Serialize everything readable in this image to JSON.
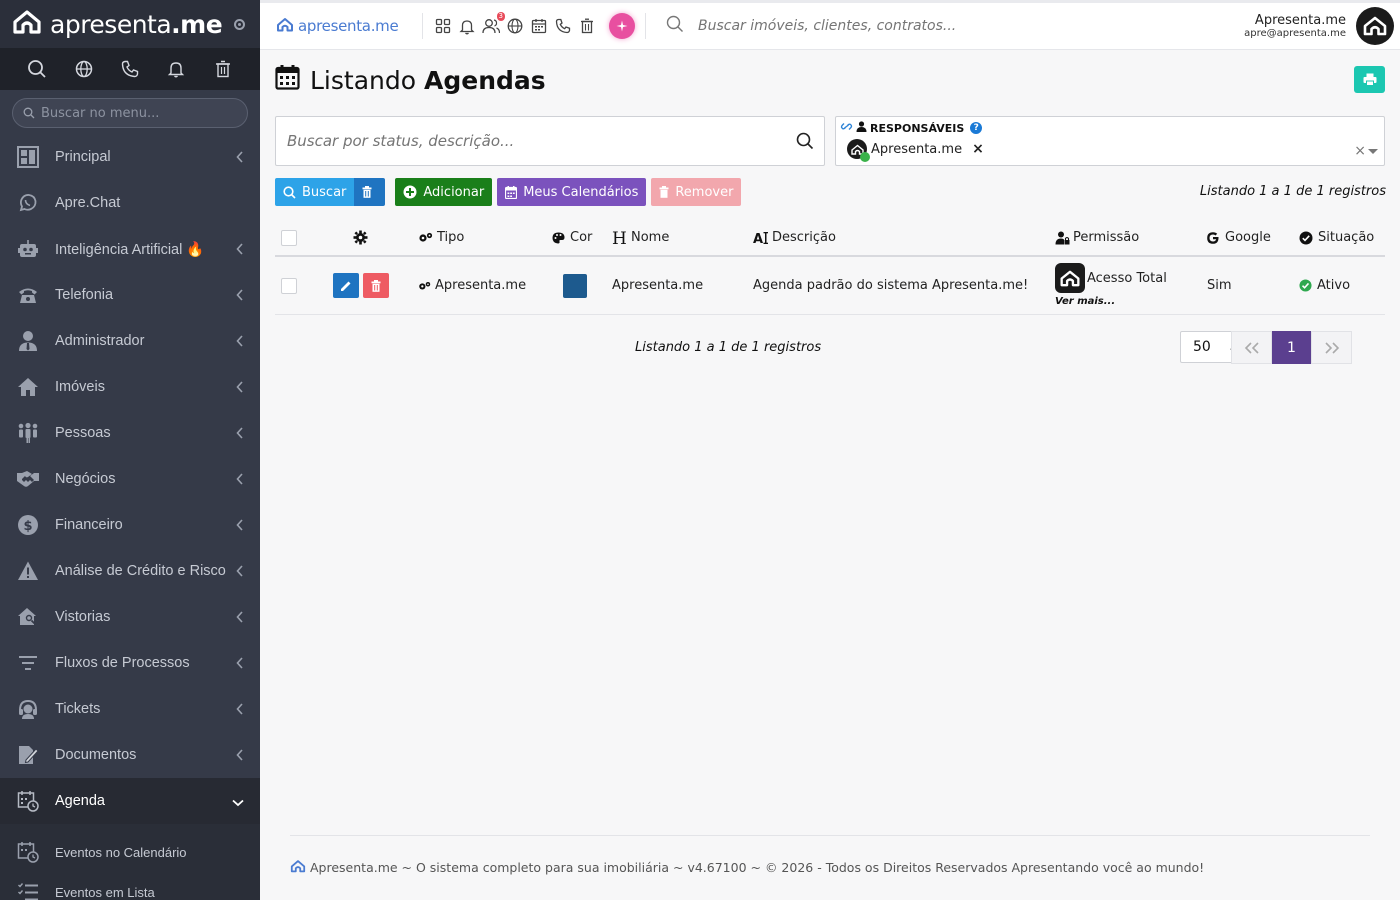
{
  "app": {
    "brand": "apresenta",
    "brand_suffix": ".me",
    "top_brand": "apresenta.me"
  },
  "sidebar": {
    "search_placeholder": "Buscar no menu...",
    "quick_icons": [
      "search-icon",
      "globe-icon",
      "phone-icon",
      "bell-icon",
      "trash-icon"
    ],
    "items": [
      {
        "label": "Principal",
        "icon": "dashboard-icon",
        "has_children": true
      },
      {
        "label": "Apre.Chat",
        "icon": "whatsapp-icon",
        "has_children": false
      },
      {
        "label": "Inteligência Artificial 🔥",
        "icon": "robot-icon",
        "has_children": true
      },
      {
        "label": "Telefonia",
        "icon": "phone-icon",
        "has_children": true
      },
      {
        "label": "Administrador",
        "icon": "user-tie-icon",
        "has_children": true
      },
      {
        "label": "Imóveis",
        "icon": "home-icon",
        "has_children": true
      },
      {
        "label": "Pessoas",
        "icon": "people-icon",
        "has_children": true
      },
      {
        "label": "Negócios",
        "icon": "handshake-icon",
        "has_children": true
      },
      {
        "label": "Financeiro",
        "icon": "dollar-icon",
        "has_children": true
      },
      {
        "label": "Análise de Crédito e Risco",
        "icon": "warning-icon",
        "has_children": true
      },
      {
        "label": "Vistorias",
        "icon": "house-search-icon",
        "has_children": true
      },
      {
        "label": "Fluxos de Processos",
        "icon": "filter-icon",
        "has_children": true
      },
      {
        "label": "Tickets",
        "icon": "headset-icon",
        "has_children": true
      },
      {
        "label": "Documentos",
        "icon": "document-edit-icon",
        "has_children": true
      },
      {
        "label": "Agenda",
        "icon": "calendar-clock-icon",
        "has_children": true,
        "expanded": true
      }
    ],
    "subitems": [
      {
        "label": "Eventos no Calendário",
        "icon": "calendar-clock-icon"
      },
      {
        "label": "Eventos em Lista",
        "icon": "list-icon"
      }
    ]
  },
  "topbar": {
    "icons": [
      "apps-icon",
      "bell-icon",
      "users-icon",
      "globe-icon",
      "calendar-icon",
      "phone-icon",
      "trash-icon"
    ],
    "users_badge": "3",
    "search_placeholder": "Buscar imóveis, clientes, contratos...",
    "user_name": "Apresenta.me",
    "user_email": "apre@apresenta.me"
  },
  "page": {
    "title_prefix": "Listando",
    "title_strong": "Agendas",
    "filter_placeholder": "Buscar por status, descrição...",
    "responsaveis_label": "RESPONSÁVEIS",
    "responsavel_chip": "Apresenta.me",
    "chip_remove": "×",
    "clear_all": "×"
  },
  "actions": {
    "search": "Buscar",
    "add": "Adicionar",
    "calendars": "Meus Calendários",
    "remove": "Remover"
  },
  "listing_info": "Listando 1 a 1 de 1 registros",
  "table": {
    "headers": {
      "tipo": "Tipo",
      "cor": "Cor",
      "nome": "Nome",
      "descricao": "Descrição",
      "permissao": "Permissão",
      "google": "Google",
      "situacao": "Situação"
    },
    "rows": [
      {
        "tipo": "Apresenta.me",
        "cor": "#1d5a8e",
        "nome": "Apresenta.me",
        "descricao": "Agenda padrão do sistema Apresenta.me!",
        "permissao": "Acesso Total",
        "ver_mais": "Ver mais...",
        "google": "Sim",
        "situacao": "Ativo"
      }
    ]
  },
  "pagination": {
    "info": "Listando 1 a 1 de 1 registros",
    "per_page": "50",
    "current_page": "1",
    "first": "«",
    "next": "»"
  },
  "footer": {
    "text": "Apresenta.me ~ O sistema completo para sua imobiliária ~ v4.67100 ~ © 2026 - Todos os Direitos Reservados Apresentando você ao mundo!"
  },
  "colors": {
    "sidebar_bg": "#353a48",
    "primary": "#1f74c1",
    "success": "#1a7f1a",
    "purple": "#7b52bd",
    "teal": "#1cc7b1",
    "active_page": "#5b3f8f"
  }
}
